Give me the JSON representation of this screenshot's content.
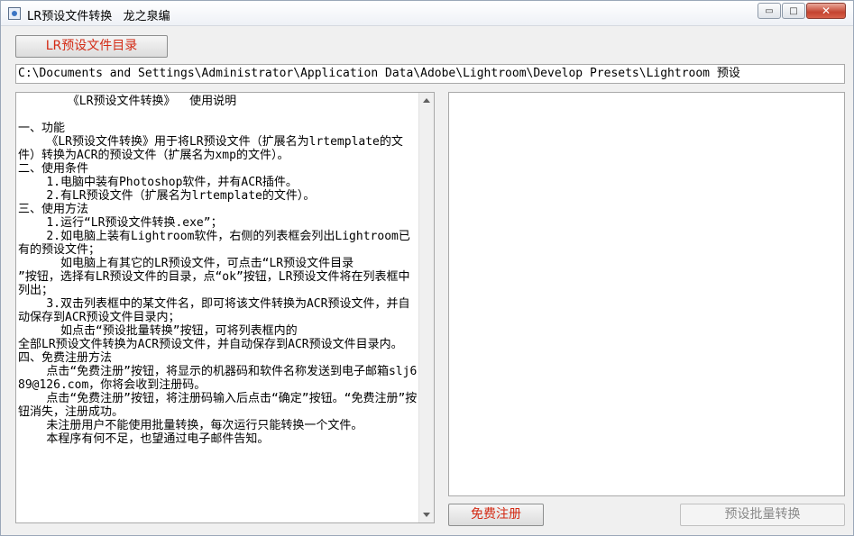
{
  "window": {
    "title": "LR预设文件转换   龙之泉编",
    "controls": {
      "minimize": "▭",
      "maximize": "□",
      "close": "✕"
    }
  },
  "toolbar": {
    "dir_button_label": "LR预设文件目录"
  },
  "path_field": {
    "value": "C:\\Documents and Settings\\Administrator\\Application Data\\Adobe\\Lightroom\\Develop Presets\\Lightroom 预设"
  },
  "instructions": {
    "text": "       《LR预设文件转换》  使用说明\n\n一、功能\n    《LR预设文件转换》用于将LR预设文件（扩展名为lrtemplate的文件）转换为ACR的预设文件（扩展名为xmp的文件）。\n二、使用条件\n    1.电脑中装有Photoshop软件，并有ACR插件。\n    2.有LR预设文件（扩展名为lrtemplate的文件）。\n三、使用方法\n    1.运行“LR预设文件转换.exe”；\n    2.如电脑上装有Lightroom软件，右侧的列表框会列出Lightroom已有的预设文件；\n      如电脑上有其它的LR预设文件，可点击“LR预设文件目录\n”按钮，选择有LR预设文件的目录，点“ok”按钮，LR预设文件将在列表框中列出；\n    3.双击列表框中的某文件名，即可将该文件转换为ACR预设文件，并自动保存到ACR预设文件目录内；\n      如点击“预设批量转换”按钮，可将列表框内的\n全部LR预设文件转换为ACR预设文件，并自动保存到ACR预设文件目录内。\n四、免费注册方法\n    点击“免费注册”按钮，将显示的机器码和软件名称发送到电子邮箱slj689@126.com，你将会收到注册码。\n    点击“免费注册”按钮，将注册码输入后点击“确定”按钮。“免费注册”按钮消失，注册成功。\n    未注册用户不能使用批量转换，每次运行只能转换一个文件。\n    本程序有何不足，也望通过电子邮件告知。"
  },
  "buttons": {
    "register_label": "免费注册",
    "batch_label": "预设批量转换"
  },
  "colors": {
    "accent_red": "#d32a14",
    "disabled_text": "#8a8a8a"
  }
}
